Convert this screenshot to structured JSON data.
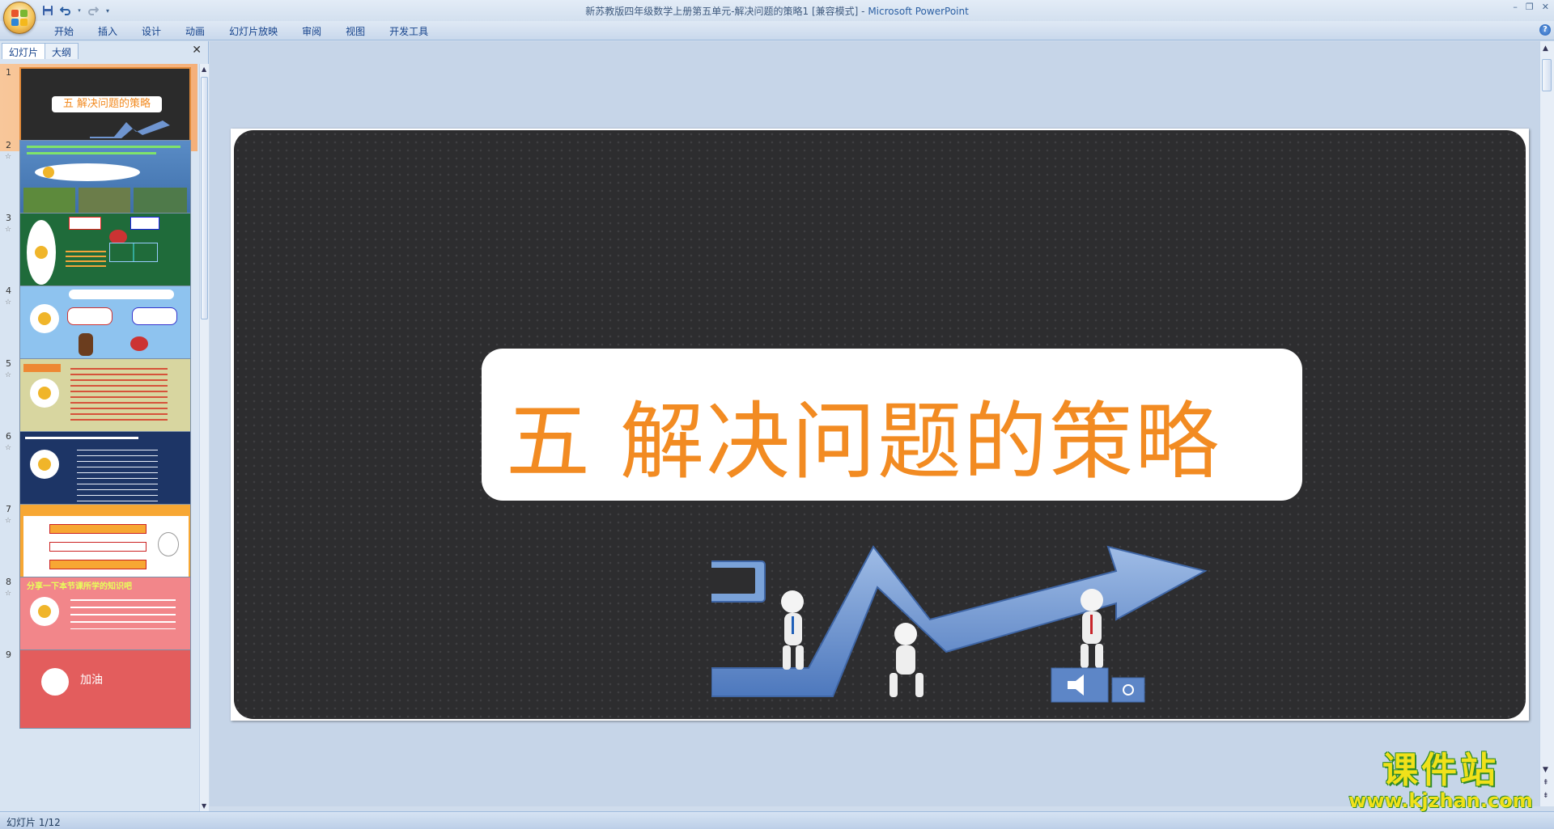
{
  "window": {
    "title": "新苏教版四年级数学上册第五单元-解决问题的策略1 [兼容模式]",
    "title_separator": " - ",
    "app_name": "Microsoft PowerPoint"
  },
  "ribbon": {
    "tabs": [
      "开始",
      "插入",
      "设计",
      "动画",
      "幻灯片放映",
      "审阅",
      "视图",
      "开发工具"
    ]
  },
  "left_pane": {
    "tabs": [
      "幻灯片",
      "大纲"
    ],
    "active_tab": "幻灯片",
    "slides": [
      {
        "number": "1",
        "selected": true,
        "text": "五 解决问题的策略",
        "bg": "#2b2b2b"
      },
      {
        "number": "2",
        "selected": false,
        "text": "",
        "bg": "#4f7fb8"
      },
      {
        "number": "3",
        "selected": false,
        "text": "",
        "bg": "#1f6b3a"
      },
      {
        "number": "4",
        "selected": false,
        "text": "",
        "bg": "#8ec3ef"
      },
      {
        "number": "5",
        "selected": false,
        "text": "",
        "bg": "#d8d6a0"
      },
      {
        "number": "6",
        "selected": false,
        "text": "",
        "bg": "#1d3566"
      },
      {
        "number": "7",
        "selected": false,
        "text": "",
        "bg": "#f7a733"
      },
      {
        "number": "8",
        "selected": false,
        "text": "分享一下本节课所学的知识吧",
        "bg": "#f2868a"
      },
      {
        "number": "9",
        "selected": false,
        "text": "加油",
        "bg": "#e35d5d"
      }
    ]
  },
  "slide": {
    "title": "五  解决问题的策略",
    "title_color": "#f28b22",
    "bg_color": "#2d2d2f"
  },
  "statusbar": {
    "slide_indicator": "幻灯片 1/12"
  },
  "watermark": {
    "text": "课件站",
    "url": "www.kjzhan.com"
  }
}
